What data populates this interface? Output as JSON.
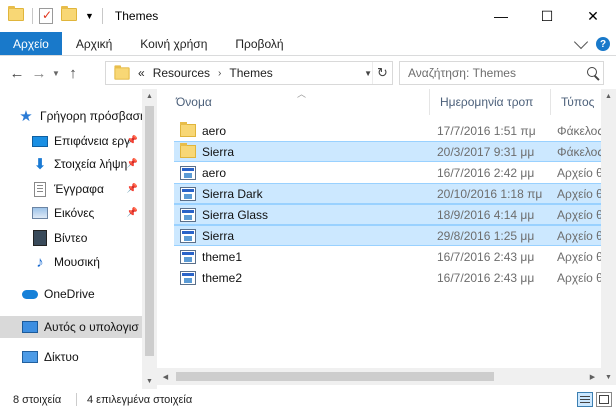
{
  "window": {
    "title": "Themes",
    "controls": {
      "minimize": "—",
      "maximize": "☐",
      "close": "✕"
    }
  },
  "ribbon": {
    "tabs": [
      "Αρχείο",
      "Αρχική",
      "Κοινή χρήση",
      "Προβολή"
    ],
    "help": "?"
  },
  "address": {
    "prefix": "«",
    "crumbs": [
      "Resources",
      "Themes"
    ],
    "separator": "›"
  },
  "search": {
    "placeholder": "Αναζήτηση: Themes"
  },
  "sidebar": {
    "items": [
      {
        "label": "Γρήγορη πρόσβαση",
        "icon": "star-icon",
        "pinned": false,
        "selected": false
      },
      {
        "label": "Επιφάνεια εργ",
        "icon": "desktop-icon",
        "pinned": true,
        "selected": false
      },
      {
        "label": "Στοιχεία λήψη",
        "icon": "download-icon",
        "pinned": true,
        "selected": false
      },
      {
        "label": "Έγγραφα",
        "icon": "document-icon",
        "pinned": true,
        "selected": false
      },
      {
        "label": "Εικόνες",
        "icon": "pictures-icon",
        "pinned": true,
        "selected": false
      },
      {
        "label": "Βίντεο",
        "icon": "video-icon",
        "pinned": false,
        "selected": false
      },
      {
        "label": "Μουσική",
        "icon": "music-icon",
        "pinned": false,
        "selected": false
      },
      {
        "label": "OneDrive",
        "icon": "onedrive-icon",
        "pinned": false,
        "selected": false
      },
      {
        "label": "Αυτός ο υπολογισ",
        "icon": "this-pc-icon",
        "pinned": false,
        "selected": true
      },
      {
        "label": "Δίκτυο",
        "icon": "network-icon",
        "pinned": false,
        "selected": false
      }
    ]
  },
  "columns": [
    "Όνομα",
    "Ημερομηνία τροπ",
    "Τύπος"
  ],
  "files": [
    {
      "name": "aero",
      "date": "17/7/2016 1:51 πμ",
      "type": "Φάκελος α",
      "kind": "folder",
      "selected": false
    },
    {
      "name": "Sierra",
      "date": "20/3/2017 9:31 μμ",
      "type": "Φάκελος α",
      "kind": "folder",
      "selected": true
    },
    {
      "name": "aero",
      "date": "16/7/2016 2:42 μμ",
      "type": "Αρχείο θέμ",
      "kind": "theme",
      "selected": false
    },
    {
      "name": "Sierra Dark",
      "date": "20/10/2016 1:18 πμ",
      "type": "Αρχείο θέμ",
      "kind": "theme",
      "selected": true
    },
    {
      "name": "Sierra Glass",
      "date": "18/9/2016 4:14 μμ",
      "type": "Αρχείο θέμ",
      "kind": "theme",
      "selected": true
    },
    {
      "name": "Sierra",
      "date": "29/8/2016 1:25 μμ",
      "type": "Αρχείο θέμ",
      "kind": "theme",
      "selected": true
    },
    {
      "name": "theme1",
      "date": "16/7/2016 2:43 μμ",
      "type": "Αρχείο θέμ",
      "kind": "theme",
      "selected": false
    },
    {
      "name": "theme2",
      "date": "16/7/2016 2:43 μμ",
      "type": "Αρχείο θέμ",
      "kind": "theme",
      "selected": false
    }
  ],
  "status": {
    "count": "8 στοιχεία",
    "selected": "4 επιλεγμένα στοιχεία"
  },
  "colors": {
    "accent": "#1979ca",
    "selection": "#cce8ff",
    "selection_border": "#99d1ff"
  }
}
